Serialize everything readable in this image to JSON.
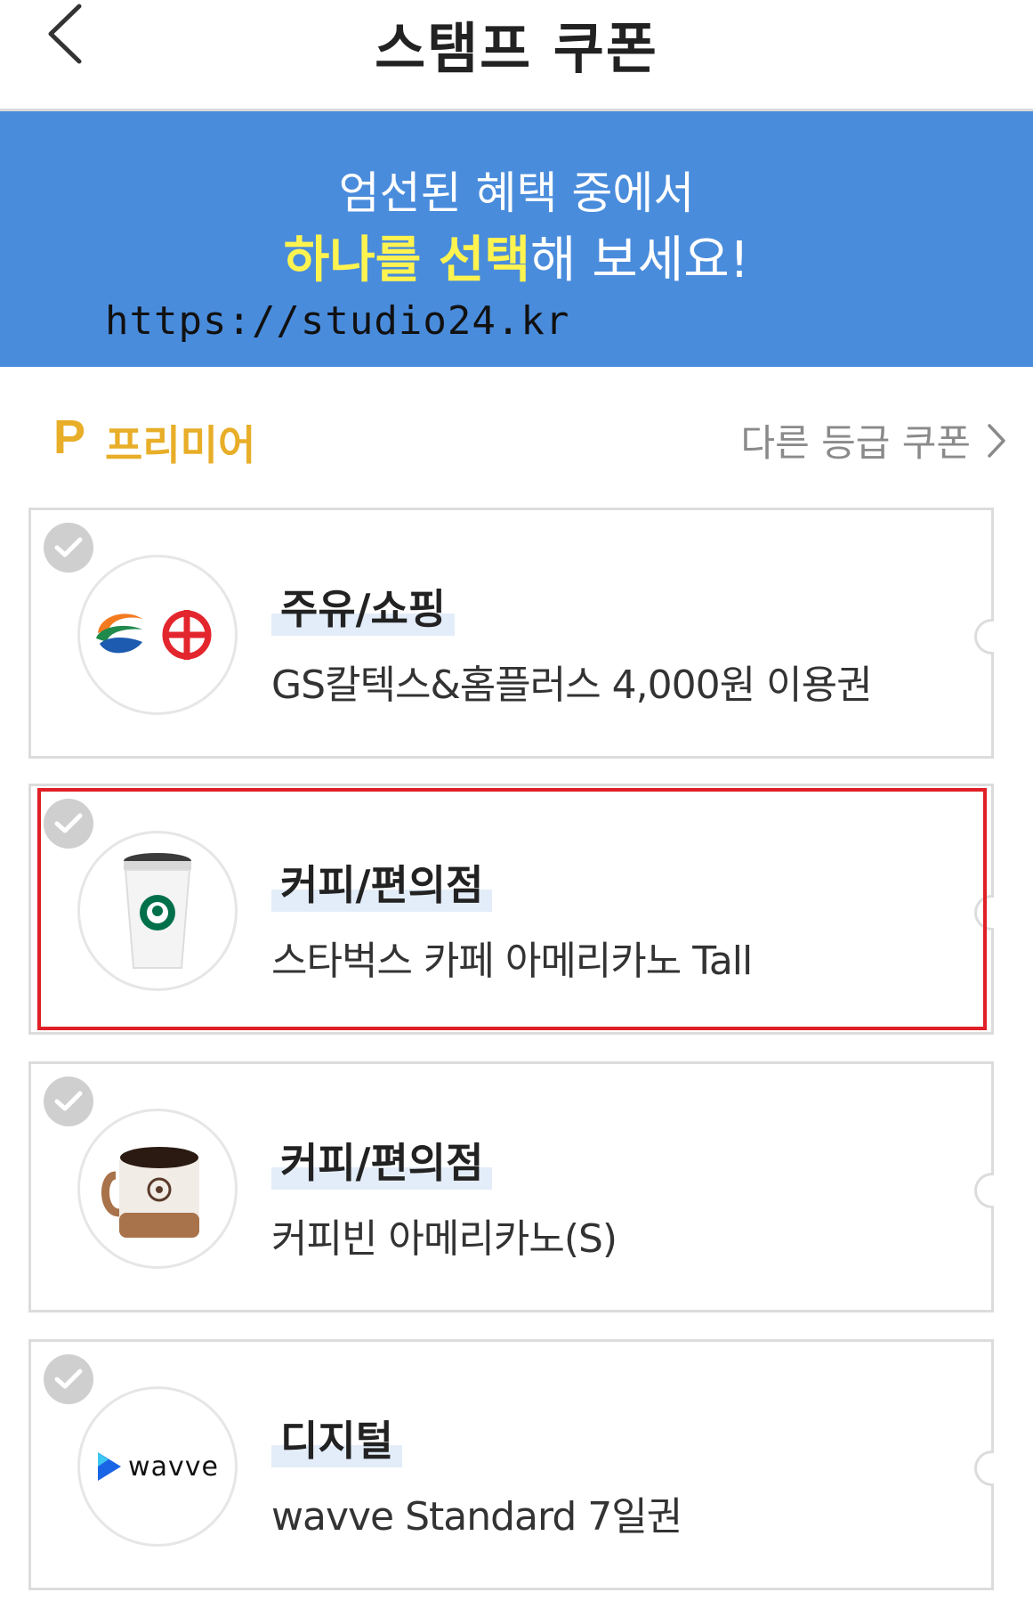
{
  "header": {
    "title": "스탬프 쿠폰",
    "back_icon": "chevron-left-icon"
  },
  "banner": {
    "line1": "엄선된 혜택 중에서",
    "line2_highlight": "하나를 선택",
    "line2_rest": "해 보세요!",
    "watermark": "https://studio24.kr",
    "background_color": "#4a8cdc",
    "highlight_color": "#fff44f"
  },
  "grade": {
    "icon_letter": "P",
    "name": "프리미어",
    "other_link": "다른 등급 쿠폰",
    "accent_color": "#e8ae28"
  },
  "coupons": [
    {
      "category": "주유/쇼핑",
      "description": "GS칼텍스&홈플러스 4,000원 이용권",
      "logo": "gs-caltex-homeplus-logo",
      "selected": false
    },
    {
      "category": "커피/편의점",
      "description": "스타벅스 카페 아메리카노 Tall",
      "logo": "starbucks-cup-image",
      "selected": true
    },
    {
      "category": "커피/편의점",
      "description": "커피빈 아메리카노(S)",
      "logo": "coffeebean-mug-image",
      "selected": false
    },
    {
      "category": "디지털",
      "description": "wavve Standard 7일권",
      "logo": "wavve-logo",
      "logo_text": "wavve",
      "selected": false
    }
  ]
}
